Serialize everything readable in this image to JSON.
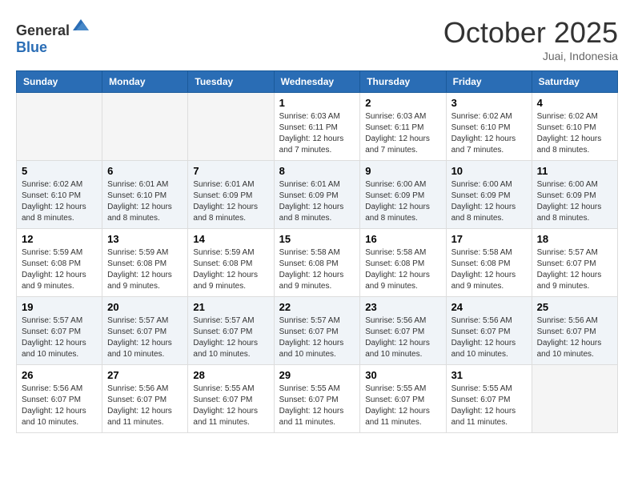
{
  "header": {
    "logo": {
      "general": "General",
      "blue": "Blue"
    },
    "title": "October 2025",
    "location": "Juai, Indonesia"
  },
  "weekdays": [
    "Sunday",
    "Monday",
    "Tuesday",
    "Wednesday",
    "Thursday",
    "Friday",
    "Saturday"
  ],
  "weeks": [
    [
      {
        "day": "",
        "empty": true
      },
      {
        "day": "",
        "empty": true
      },
      {
        "day": "",
        "empty": true
      },
      {
        "day": "1",
        "sunrise": "6:03 AM",
        "sunset": "6:11 PM",
        "daylight": "12 hours and 7 minutes."
      },
      {
        "day": "2",
        "sunrise": "6:03 AM",
        "sunset": "6:11 PM",
        "daylight": "12 hours and 7 minutes."
      },
      {
        "day": "3",
        "sunrise": "6:02 AM",
        "sunset": "6:10 PM",
        "daylight": "12 hours and 7 minutes."
      },
      {
        "day": "4",
        "sunrise": "6:02 AM",
        "sunset": "6:10 PM",
        "daylight": "12 hours and 8 minutes."
      }
    ],
    [
      {
        "day": "5",
        "sunrise": "6:02 AM",
        "sunset": "6:10 PM",
        "daylight": "12 hours and 8 minutes."
      },
      {
        "day": "6",
        "sunrise": "6:01 AM",
        "sunset": "6:10 PM",
        "daylight": "12 hours and 8 minutes."
      },
      {
        "day": "7",
        "sunrise": "6:01 AM",
        "sunset": "6:09 PM",
        "daylight": "12 hours and 8 minutes."
      },
      {
        "day": "8",
        "sunrise": "6:01 AM",
        "sunset": "6:09 PM",
        "daylight": "12 hours and 8 minutes."
      },
      {
        "day": "9",
        "sunrise": "6:00 AM",
        "sunset": "6:09 PM",
        "daylight": "12 hours and 8 minutes."
      },
      {
        "day": "10",
        "sunrise": "6:00 AM",
        "sunset": "6:09 PM",
        "daylight": "12 hours and 8 minutes."
      },
      {
        "day": "11",
        "sunrise": "6:00 AM",
        "sunset": "6:09 PM",
        "daylight": "12 hours and 8 minutes."
      }
    ],
    [
      {
        "day": "12",
        "sunrise": "5:59 AM",
        "sunset": "6:08 PM",
        "daylight": "12 hours and 9 minutes."
      },
      {
        "day": "13",
        "sunrise": "5:59 AM",
        "sunset": "6:08 PM",
        "daylight": "12 hours and 9 minutes."
      },
      {
        "day": "14",
        "sunrise": "5:59 AM",
        "sunset": "6:08 PM",
        "daylight": "12 hours and 9 minutes."
      },
      {
        "day": "15",
        "sunrise": "5:58 AM",
        "sunset": "6:08 PM",
        "daylight": "12 hours and 9 minutes."
      },
      {
        "day": "16",
        "sunrise": "5:58 AM",
        "sunset": "6:08 PM",
        "daylight": "12 hours and 9 minutes."
      },
      {
        "day": "17",
        "sunrise": "5:58 AM",
        "sunset": "6:08 PM",
        "daylight": "12 hours and 9 minutes."
      },
      {
        "day": "18",
        "sunrise": "5:57 AM",
        "sunset": "6:07 PM",
        "daylight": "12 hours and 9 minutes."
      }
    ],
    [
      {
        "day": "19",
        "sunrise": "5:57 AM",
        "sunset": "6:07 PM",
        "daylight": "12 hours and 10 minutes."
      },
      {
        "day": "20",
        "sunrise": "5:57 AM",
        "sunset": "6:07 PM",
        "daylight": "12 hours and 10 minutes."
      },
      {
        "day": "21",
        "sunrise": "5:57 AM",
        "sunset": "6:07 PM",
        "daylight": "12 hours and 10 minutes."
      },
      {
        "day": "22",
        "sunrise": "5:57 AM",
        "sunset": "6:07 PM",
        "daylight": "12 hours and 10 minutes."
      },
      {
        "day": "23",
        "sunrise": "5:56 AM",
        "sunset": "6:07 PM",
        "daylight": "12 hours and 10 minutes."
      },
      {
        "day": "24",
        "sunrise": "5:56 AM",
        "sunset": "6:07 PM",
        "daylight": "12 hours and 10 minutes."
      },
      {
        "day": "25",
        "sunrise": "5:56 AM",
        "sunset": "6:07 PM",
        "daylight": "12 hours and 10 minutes."
      }
    ],
    [
      {
        "day": "26",
        "sunrise": "5:56 AM",
        "sunset": "6:07 PM",
        "daylight": "12 hours and 10 minutes."
      },
      {
        "day": "27",
        "sunrise": "5:56 AM",
        "sunset": "6:07 PM",
        "daylight": "12 hours and 11 minutes."
      },
      {
        "day": "28",
        "sunrise": "5:55 AM",
        "sunset": "6:07 PM",
        "daylight": "12 hours and 11 minutes."
      },
      {
        "day": "29",
        "sunrise": "5:55 AM",
        "sunset": "6:07 PM",
        "daylight": "12 hours and 11 minutes."
      },
      {
        "day": "30",
        "sunrise": "5:55 AM",
        "sunset": "6:07 PM",
        "daylight": "12 hours and 11 minutes."
      },
      {
        "day": "31",
        "sunrise": "5:55 AM",
        "sunset": "6:07 PM",
        "daylight": "12 hours and 11 minutes."
      },
      {
        "day": "",
        "empty": true
      }
    ]
  ],
  "labels": {
    "sunrise": "Sunrise:",
    "sunset": "Sunset:",
    "daylight": "Daylight:"
  }
}
